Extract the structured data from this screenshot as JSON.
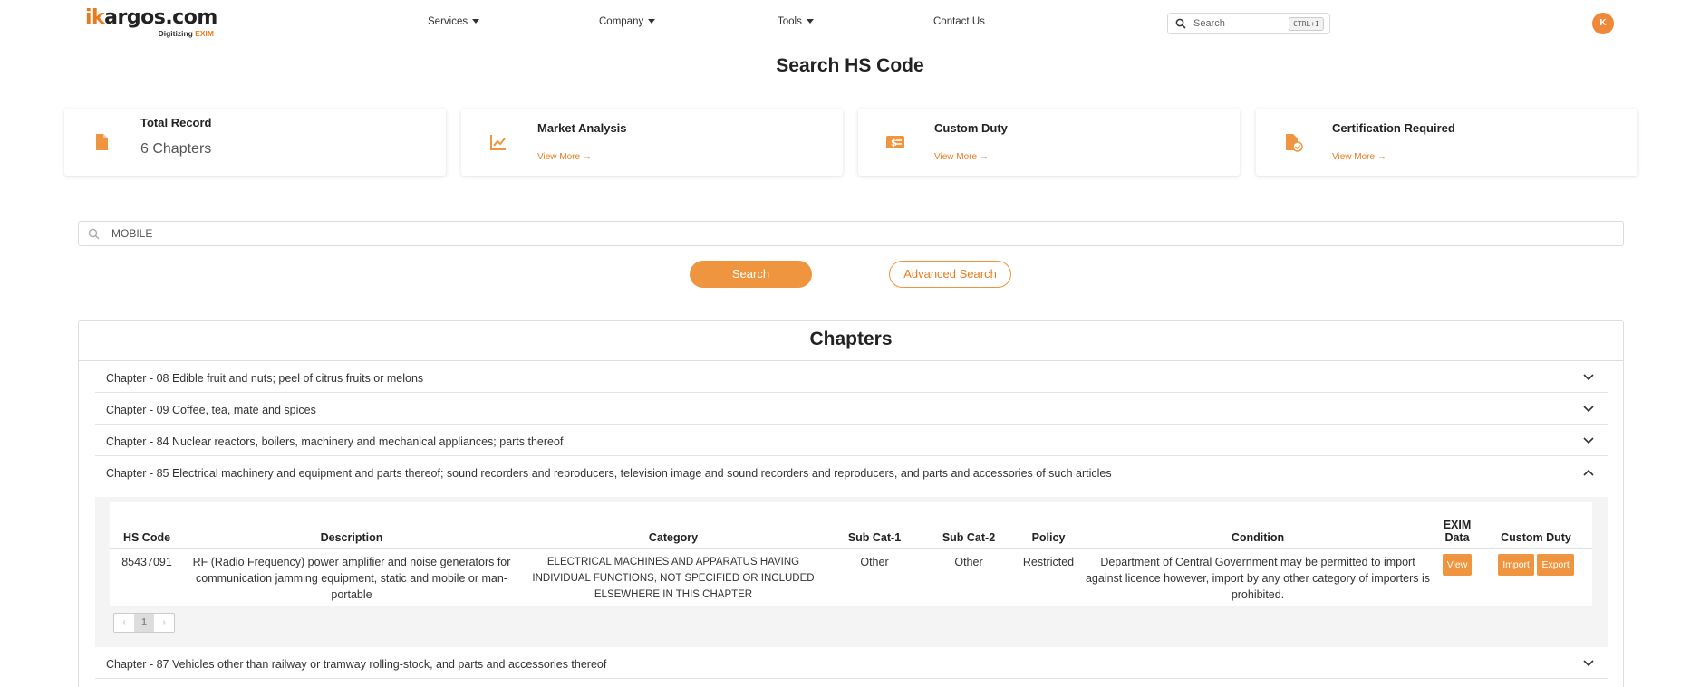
{
  "header": {
    "logo_prefix": "ik",
    "logo_rest": "argos.com",
    "logo_tag": "Digitizing",
    "logo_tag_accent": "EXIM",
    "nav": {
      "services": "Services",
      "company": "Company",
      "tools": "Tools",
      "contact": "Contact Us"
    },
    "search_placeholder": "Search",
    "search_shortcut": "CTRL+I",
    "avatar_initial": "K"
  },
  "page_title": "Search HS Code",
  "cards": {
    "total_record": {
      "title": "Total Record",
      "value": "6 Chapters",
      "icon": "file-icon"
    },
    "market_analysis": {
      "title": "Market Analysis",
      "link": "View More",
      "icon": "chart-line-icon"
    },
    "custom_duty": {
      "title": "Custom Duty",
      "link": "View More",
      "icon": "money-bill-icon"
    },
    "certification": {
      "title": "Certification Required",
      "link": "View More",
      "icon": "file-check-icon"
    }
  },
  "search": {
    "value": "MOBILE",
    "button": "Search",
    "advanced_button": "Advanced Search"
  },
  "chapters": {
    "heading": "Chapters",
    "items": [
      "Chapter - 08 Edible fruit and nuts; peel of citrus fruits or melons",
      "Chapter - 09 Coffee, tea, mate and spices",
      "Chapter - 84 Nuclear reactors, boilers, machinery and mechanical appliances; parts thereof",
      "Chapter - 85 Electrical machinery and equipment and parts thereof; sound recorders and reproducers, television image and sound recorders and reproducers, and parts and accessories of such articles",
      "Chapter - 87 Vehicles other than railway or tramway rolling-stock, and parts and accessories thereof"
    ]
  },
  "table": {
    "headers": {
      "hs_code": "HS Code",
      "description": "Description",
      "category": "Category",
      "sub_cat_1": "Sub Cat-1",
      "sub_cat_2": "Sub Cat-2",
      "policy": "Policy",
      "condition": "Condition",
      "exim_data_line1": "EXIM",
      "exim_data_line2": "Data",
      "custom_duty": "Custom Duty"
    },
    "row": {
      "hs_code": "85437091",
      "description": "RF (Radio Frequency) power amplifier and noise generators for communication jamming equipment, static and mobile or man-portable",
      "category": "ELECTRICAL MACHINES AND APPARATUS HAVING INDIVIDUAL FUNCTIONS, NOT SPECIFIED OR INCLUDED ELSEWHERE IN THIS CHAPTER",
      "sub_cat_1": "Other",
      "sub_cat_2": "Other",
      "policy": "Restricted",
      "condition": "Department of Central Government may be permitted to import against licence however, import by any other category of importers is prohibited.",
      "view": "View",
      "import": "Import",
      "export": "Export"
    },
    "pagination": {
      "prev": "‹",
      "current": "1",
      "next": "›"
    }
  },
  "colors": {
    "accent": "#f0953f",
    "accent_text": "#e87b1e"
  }
}
